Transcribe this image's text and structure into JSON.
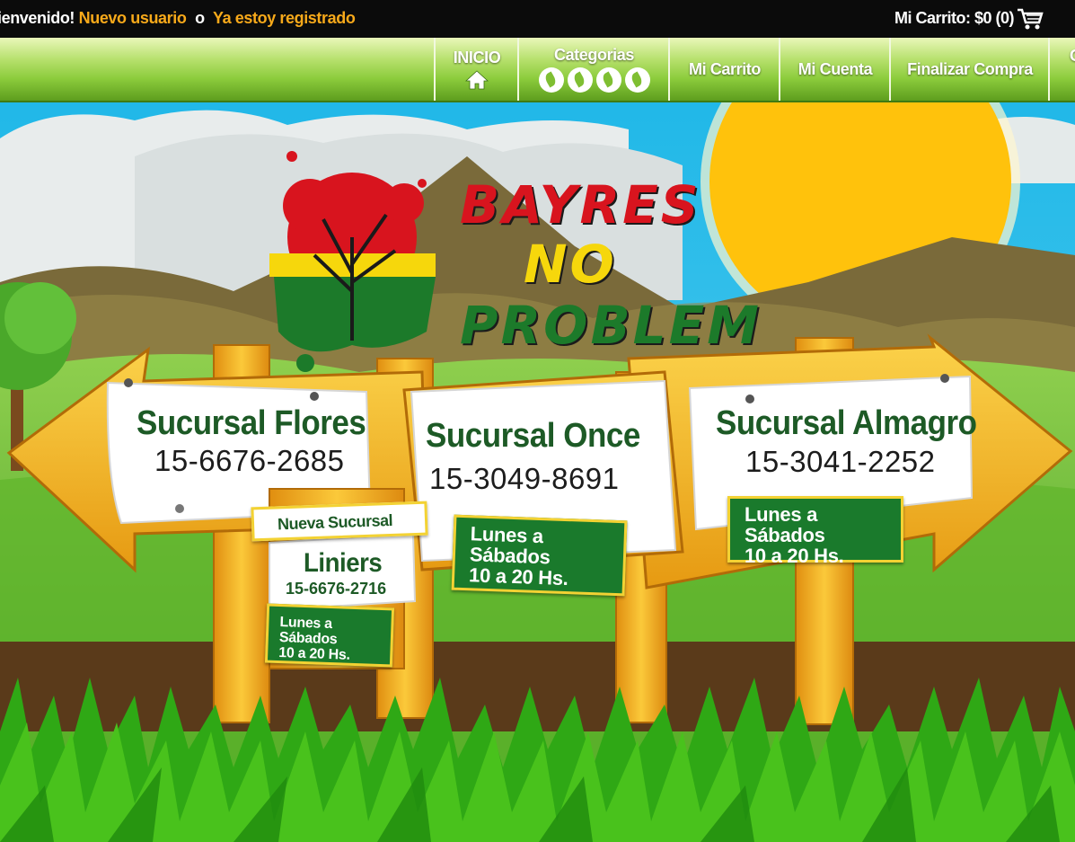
{
  "topbar": {
    "welcome": "ienvenido!",
    "new_user": "Nuevo usuario",
    "or": "o",
    "registered": "Ya estoy registrado",
    "cart": "Mi Carrito: $0 (0)",
    "cart_icon": "shopping-cart-icon"
  },
  "nav": {
    "home_label": "INICIO",
    "home_icon": "home-icon",
    "categories_label": "Categorias",
    "category_icons": [
      "leaf-icon",
      "leaf-icon",
      "leaf-icon",
      "leaf-icon"
    ],
    "cart_label": "Mi Carrito",
    "account_label": "Mi Cuenta",
    "checkout_label": "Finalizar Compra",
    "partial_label": "C"
  },
  "logo": {
    "line1": "BAYRES",
    "line2": "NO",
    "line3": "PROBLEM",
    "colors": {
      "red": "#d8141e",
      "yellow": "#f6d70c",
      "green": "#1c7a2a"
    }
  },
  "branches": [
    {
      "name": "Sucursal Flores",
      "phone": "15-6676-2685"
    },
    {
      "name": "Sucursal Once",
      "phone": "15-3049-8691",
      "hours_line1": "Lunes a Sábados",
      "hours_line2": "10 a 20 Hs."
    },
    {
      "name": "Sucursal Almagro",
      "phone": "15-3041-2252",
      "hours_line1": "Lunes a Sábados",
      "hours_line2": "10 a 20 Hs."
    }
  ],
  "new_branch": {
    "tag": "Nueva Sucursal",
    "name": "Liniers",
    "phone": "15-6676-2716",
    "hours_line1": "Lunes a Sábados",
    "hours_line2": "10 a 20 Hs."
  }
}
